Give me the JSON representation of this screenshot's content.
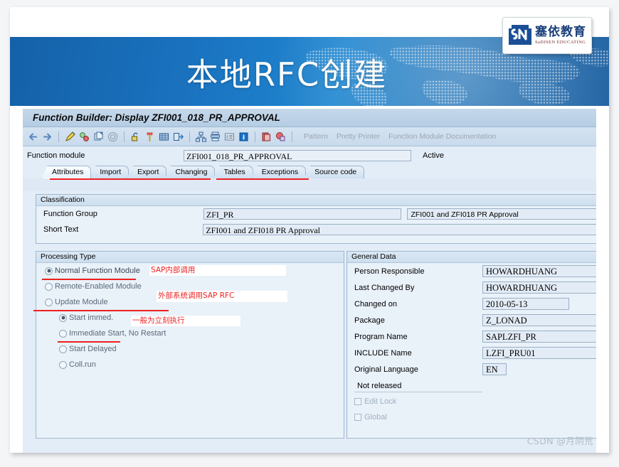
{
  "slide": {
    "banner_title": "本地RFC创建",
    "logo": {
      "mark": "sn-monogram",
      "cn_name": "塞依教育",
      "en_name": "SaDISEN EDUCATING"
    }
  },
  "sap": {
    "window_title": "Function Builder: Display ZFI001_018_PR_APPROVAL",
    "toolbar": {
      "icons": [
        "back-arrow-icon",
        "forward-arrow-icon",
        "pencil-display-change-icon",
        "activate-icon",
        "copy-icon",
        "where-used-icon",
        "unlock-icon",
        "test-icon",
        "debug-icon",
        "navigate-icon",
        "hierarchy-icon",
        "stack-icon",
        "list-icon",
        "info-icon",
        "clipboard-icon",
        "object-list-icon"
      ],
      "text_buttons": [
        "Pattern",
        "Pretty Printer",
        "Function Module Documentation"
      ]
    },
    "function_module": {
      "label": "Function module",
      "value": "ZFI001_018_PR_APPROVAL",
      "status": "Active"
    },
    "tabs": [
      {
        "label": "Attributes",
        "active": true
      },
      {
        "label": "Import",
        "active": false
      },
      {
        "label": "Export",
        "active": false
      },
      {
        "label": "Changing",
        "active": false
      },
      {
        "label": "Tables",
        "active": false
      },
      {
        "label": "Exceptions",
        "active": false
      },
      {
        "label": "Source code",
        "active": false
      }
    ],
    "classification": {
      "title": "Classification",
      "function_group_label": "Function Group",
      "function_group_value": "ZFI_PR",
      "function_group_desc": "ZFI001 and ZFI018 PR Approval",
      "short_text_label": "Short Text",
      "short_text_value": "ZFI001 and ZFI018 PR Approval"
    },
    "processing_type": {
      "title": "Processing Type",
      "options": [
        {
          "label": "Normal Function Module",
          "selected": true,
          "indent": false
        },
        {
          "label": "Remote-Enabled Module",
          "selected": false,
          "indent": false
        },
        {
          "label": "Update Module",
          "selected": false,
          "indent": false
        },
        {
          "label": "Start immed.",
          "selected": true,
          "indent": true
        },
        {
          "label": "Immediate Start, No Restart",
          "selected": false,
          "indent": true
        },
        {
          "label": "Start Delayed",
          "selected": false,
          "indent": true
        },
        {
          "label": "Coll.run",
          "selected": false,
          "indent": true
        }
      ]
    },
    "general_data": {
      "title": "General Data",
      "rows": [
        {
          "label": "Person Responsible",
          "value": "HOWARDHUANG"
        },
        {
          "label": "Last Changed By",
          "value": "HOWARDHUANG"
        },
        {
          "label": "Changed on",
          "value": "2010-05-13"
        },
        {
          "label": "Package",
          "value": "Z_LONAD"
        },
        {
          "label": "Program Name",
          "value": "SAPLZFI_PR"
        },
        {
          "label": "INCLUDE Name",
          "value": "LZFI_PRU01"
        },
        {
          "label": "Original Language",
          "value": "EN"
        }
      ],
      "release_status": "Not released",
      "checkboxes": [
        {
          "label": "Edit Lock",
          "checked": false
        },
        {
          "label": "Global",
          "checked": false
        }
      ]
    }
  },
  "annotations": [
    {
      "text": "SAP内部调用",
      "target": "normal-function-module"
    },
    {
      "text": "外部系统调用SAP RFC",
      "target": "remote-enabled-module"
    },
    {
      "text": "一般为立刻执行",
      "target": "start-immed"
    }
  ],
  "watermark": "CSDN @月阴荒",
  "colors": {
    "banner_blue": "#1a72bf",
    "annotation_red": "#ef2020",
    "sap_bg": "#e3edf7",
    "title_bar": "#b5cde4"
  }
}
